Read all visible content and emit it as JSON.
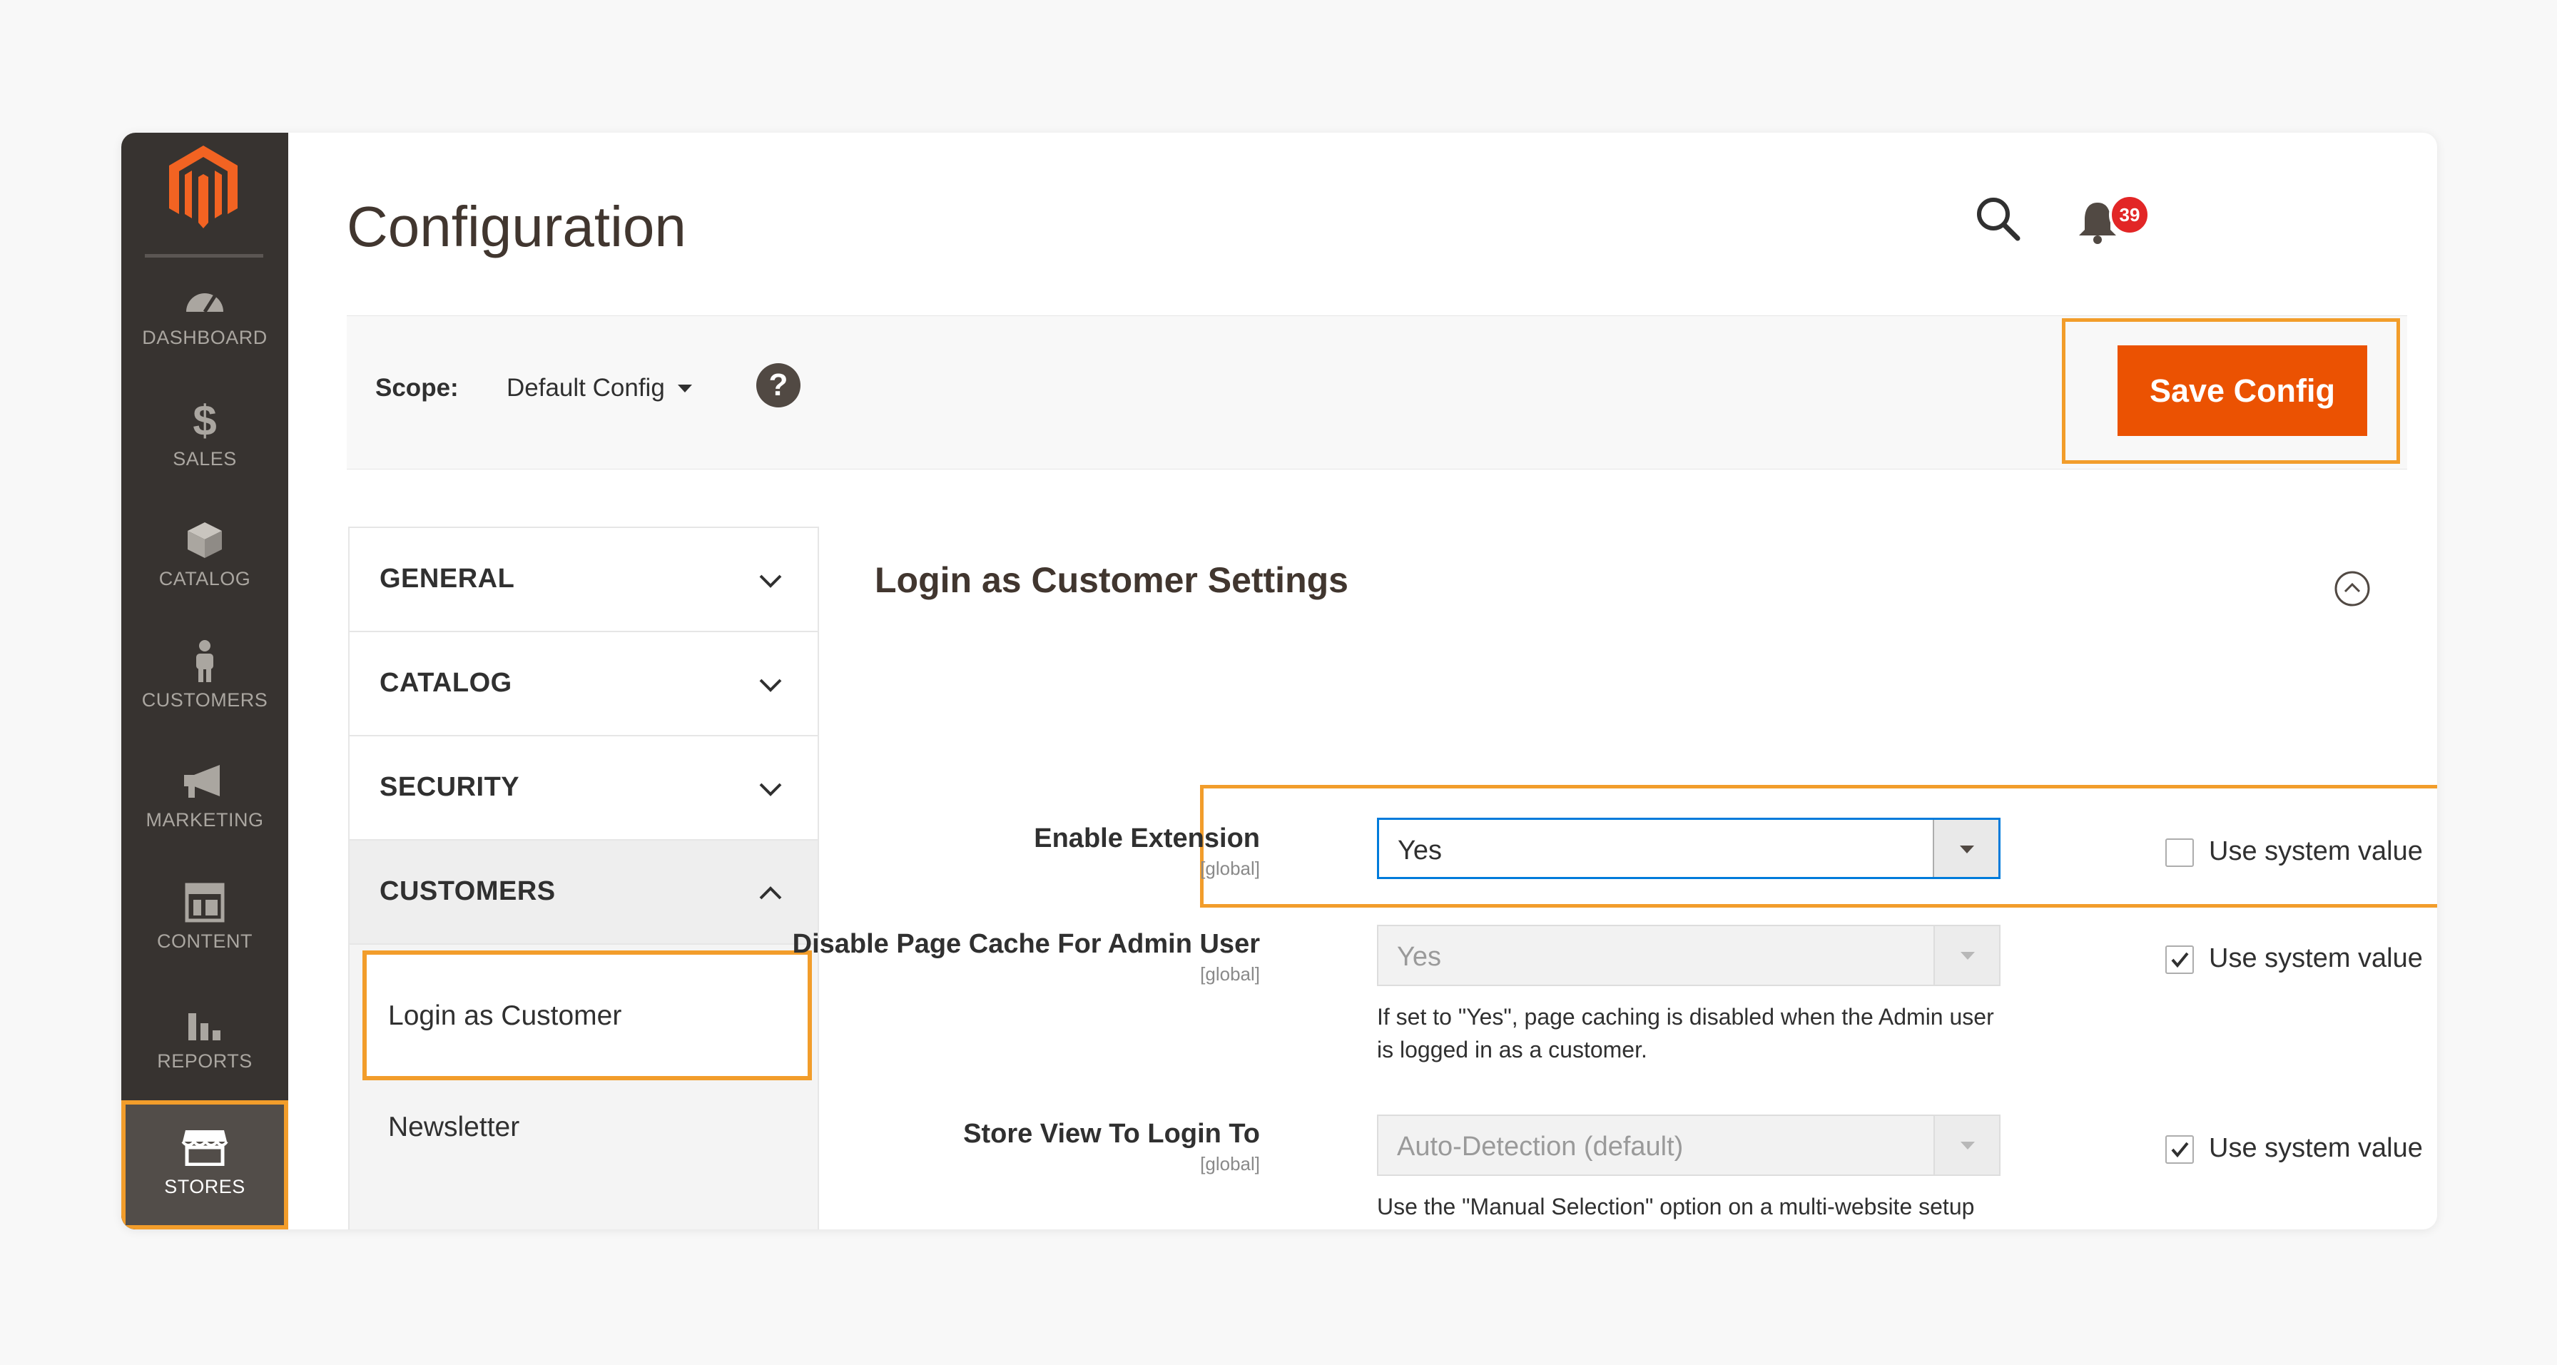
{
  "colors": {
    "accent": "#eb5202",
    "highlight": "#f29d2b",
    "sidebar": "#373330",
    "badge": "#e22626"
  },
  "sidebar": {
    "logo": "magento-logo",
    "items": [
      {
        "label": "DASHBOARD",
        "icon": "dashboard-icon"
      },
      {
        "label": "SALES",
        "icon": "dollar-icon"
      },
      {
        "label": "CATALOG",
        "icon": "box-icon"
      },
      {
        "label": "CUSTOMERS",
        "icon": "person-icon"
      },
      {
        "label": "MARKETING",
        "icon": "megaphone-icon"
      },
      {
        "label": "CONTENT",
        "icon": "layout-icon"
      },
      {
        "label": "REPORTS",
        "icon": "bar-chart-icon"
      },
      {
        "label": "STORES",
        "icon": "store-icon",
        "active": true
      }
    ]
  },
  "header": {
    "title": "Configuration",
    "notifications_count": "39"
  },
  "scope": {
    "label": "Scope:",
    "value": "Default Config",
    "help": "?"
  },
  "actions": {
    "save_label": "Save Config"
  },
  "tabs": [
    {
      "label": "GENERAL",
      "open": false
    },
    {
      "label": "CATALOG",
      "open": false
    },
    {
      "label": "SECURITY",
      "open": false
    },
    {
      "label": "CUSTOMERS",
      "open": true,
      "items": [
        "Login as Customer",
        "Newsletter"
      ],
      "active_item": "Login as Customer"
    }
  ],
  "section": {
    "title": "Login as Customer Settings",
    "fields": [
      {
        "label": "Enable Extension",
        "scope": "[global]",
        "value": "Yes",
        "use_system_value": false,
        "use_system_label": "Use system value",
        "note": ""
      },
      {
        "label": "Disable Page Cache For Admin User",
        "scope": "[global]",
        "value": "Yes",
        "use_system_value": true,
        "use_system_label": "Use system value",
        "note": "If set to \"Yes\", page caching is disabled when the Admin user is logged in as a customer."
      },
      {
        "label": "Store View To Login To",
        "scope": "[global]",
        "value": "Auto-Detection (default)",
        "use_system_value": true,
        "use_system_label": "Use system value",
        "note": "Use the \"Manual Selection\" option on a multi-website setup that has \"Share Customer Accounts\" enabled globally. If set to \"Manual Selection\", the \"Login as Customer\" admin can select a store view after logging in."
      }
    ]
  }
}
